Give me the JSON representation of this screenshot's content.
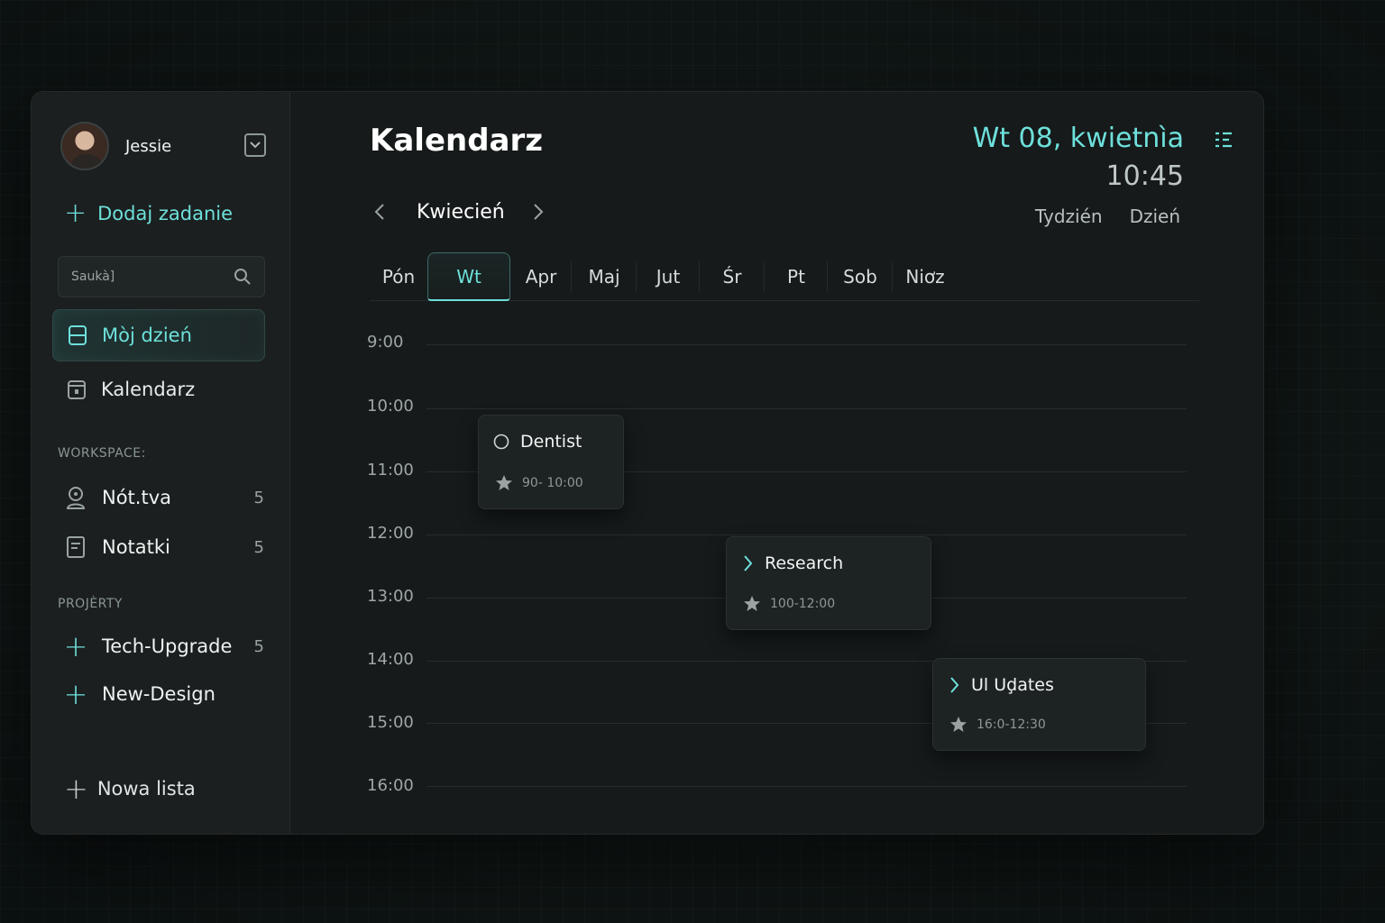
{
  "user": {
    "name": "Jessie"
  },
  "sidebar": {
    "add_task_label": "Dodaj zadanie",
    "search_placeholder": "Saukà]",
    "nav": [
      {
        "label": "Mòj dzień",
        "icon": "layout-icon",
        "active": true
      },
      {
        "label": "Kalendarz",
        "icon": "calendar-icon",
        "active": false
      }
    ],
    "workspace_title": "WORKSPACE:",
    "workspace_items": [
      {
        "label": "Nót.tva",
        "count": "5",
        "icon": "user-icon"
      },
      {
        "label": "Notatki",
        "count": "5",
        "icon": "note-icon"
      }
    ],
    "projects_title": "PROJÈRTY",
    "projects": [
      {
        "label": "Tech-Upgrade",
        "count": "5"
      },
      {
        "label": "New-Design",
        "count": ""
      }
    ],
    "new_list_label": "Nowa lista"
  },
  "main": {
    "title": "Kalendarz",
    "date": "Wt 08, kwietnìa",
    "time": "10:45",
    "month": "Kwiecień",
    "views": [
      "Tydzién",
      "Dzień"
    ],
    "days": [
      "Pón",
      "Wt",
      "Apr",
      "Maj",
      "Jut",
      "Śr",
      "Pt",
      "Sob",
      "Niơz"
    ],
    "active_day": "Wt",
    "hours": [
      "9:00",
      "10:00",
      "11:00",
      "12:00",
      "13:00",
      "14:00",
      "15:00",
      "16:00"
    ],
    "events": [
      {
        "title": "Dentist",
        "time": "90- 10:00",
        "icon": "circle-icon"
      },
      {
        "title": "Research",
        "time": "100-12:00",
        "icon": "chevron-right-icon"
      },
      {
        "title": "Ul Uḑates",
        "time": "16:0-12:30",
        "icon": "chevron-right-icon"
      }
    ]
  },
  "colors": {
    "accent": "#6ee0db",
    "panel": "#161a1a",
    "sidebar": "#1b1f1f"
  }
}
